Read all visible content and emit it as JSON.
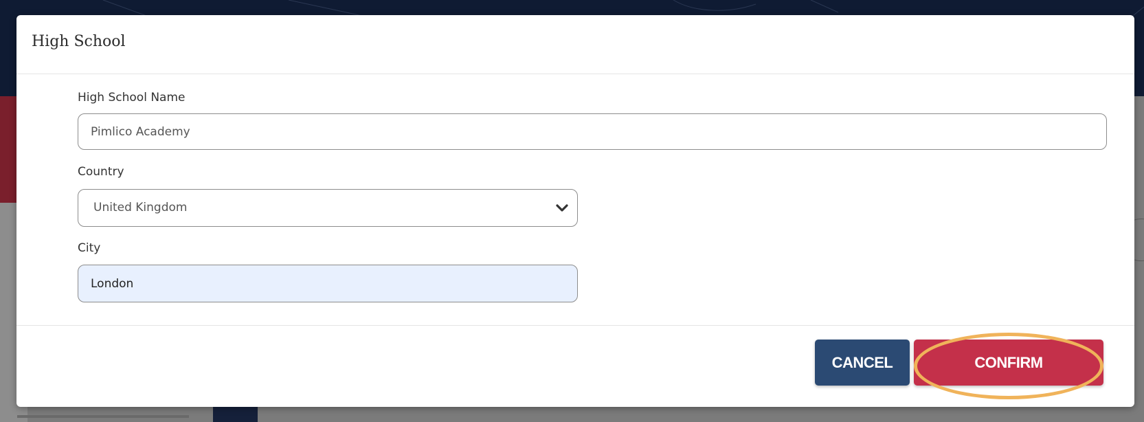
{
  "modal": {
    "title": "High School"
  },
  "form": {
    "school_name": {
      "label": "High School Name",
      "value": "Pimlico Academy"
    },
    "country": {
      "label": "Country",
      "selected": "United Kingdom"
    },
    "city": {
      "label": "City",
      "value": "London"
    }
  },
  "footer": {
    "cancel_label": "CANCEL",
    "confirm_label": "CONFIRM"
  },
  "colors": {
    "cancel": "#2b4a73",
    "confirm": "#c4304a",
    "highlight": "#f0b35a",
    "autofill": "#e8f0fe"
  },
  "icons": {
    "select_indicator": "chevron-down-icon"
  }
}
